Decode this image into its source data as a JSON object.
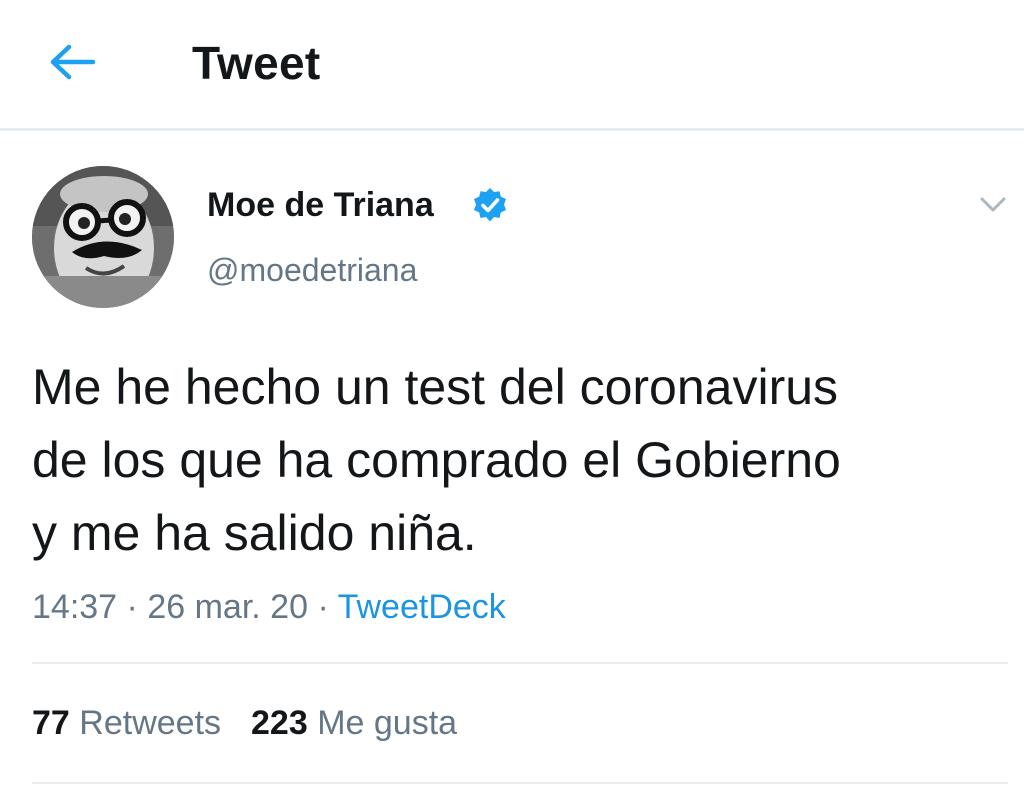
{
  "header": {
    "title": "Tweet",
    "back_icon": "arrow-left-icon",
    "accent_color": "#1da1f2"
  },
  "tweet": {
    "author": {
      "name": "Moe de Triana",
      "handle": "@moedetriana",
      "verified": true,
      "verified_icon": "verified-badge-icon",
      "verified_color": "#1da1f2"
    },
    "menu_icon": "chevron-down-icon",
    "text": "Me he hecho un test del coronavirus\nde los que ha comprado el Gobierno\ny me ha salido niña.",
    "time": "14:37",
    "date": "26 mar. 20",
    "separator": "·",
    "source": "TweetDeck",
    "source_color": "#1b95e0",
    "stats": {
      "retweets_count": "77",
      "retweets_label": "Retweets",
      "likes_count": "223",
      "likes_label": "Me gusta"
    }
  }
}
